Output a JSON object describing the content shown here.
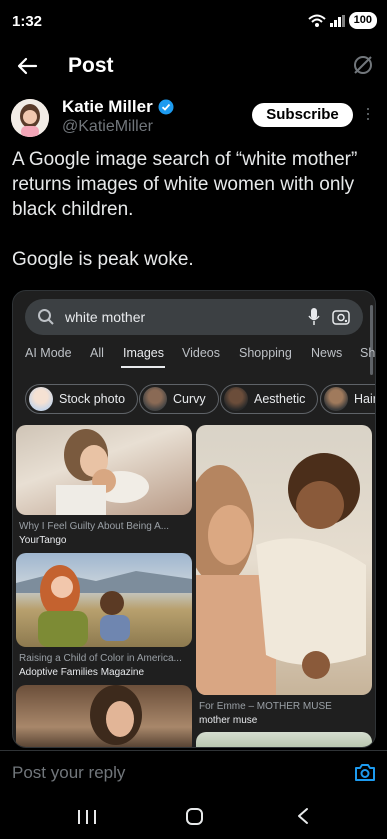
{
  "status_bar": {
    "time": "1:32",
    "battery": "100",
    "wifi_badge": "6"
  },
  "header": {
    "title": "Post"
  },
  "author": {
    "name": "Katie Miller",
    "handle": "@KatieMiller",
    "subscribe_label": "Subscribe"
  },
  "tweet": {
    "line1": "A Google image search of “white mother” returns images of white women with only black children.",
    "line2": "Google is peak woke."
  },
  "embedded": {
    "search_query": "white mother",
    "tabs": [
      "AI Mode",
      "All",
      "Images",
      "Videos",
      "Shopping",
      "News",
      "Sh"
    ],
    "active_tab": "Images",
    "chips": [
      "Stock photo",
      "Curvy",
      "Aesthetic",
      "Hair"
    ],
    "results": [
      {
        "caption": "Why I Feel Guilty About Being A...",
        "source": "YourTango"
      },
      {
        "caption": "Raising a Child of Color in America...",
        "source": "Adoptive Families Magazine"
      },
      {
        "caption": "For Emme – MOTHER MUSE",
        "source": "mother muse"
      }
    ]
  },
  "reply": {
    "placeholder": "Post your reply"
  },
  "colors": {
    "background": "#000000",
    "accent": "#1d9bf0",
    "muted": "#71767b",
    "google_surface": "#1f1f1f"
  },
  "icons": [
    "back-arrow-icon",
    "grok-icon",
    "verified-badge-icon",
    "more-icon",
    "search-icon",
    "mic-icon",
    "lens-icon",
    "camera-icon",
    "recent-apps-icon",
    "home-icon",
    "nav-back-icon"
  ]
}
